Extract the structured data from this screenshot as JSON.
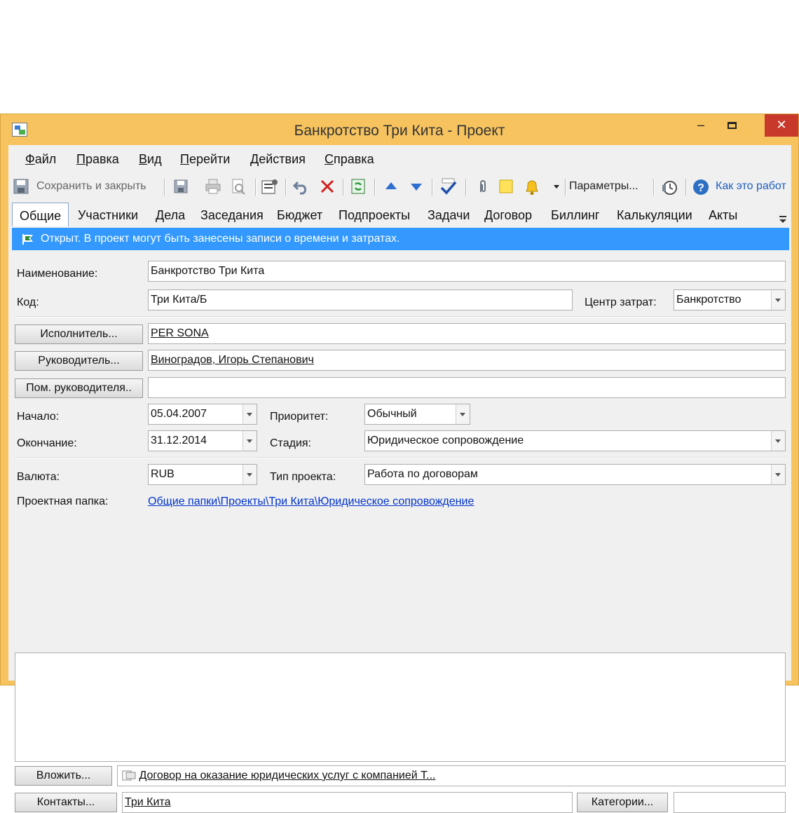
{
  "window": {
    "title": "Банкротство Три Кита - Проект",
    "minimize": "–",
    "close": "✕"
  },
  "menu": [
    "Файл",
    "Правка",
    "Вид",
    "Перейти",
    "Действия",
    "Справка"
  ],
  "toolbar": {
    "save_close": "Сохранить и закрыть",
    "params": "Параметры...",
    "help": "Как это работ"
  },
  "tabs": [
    "Общие",
    "Участники",
    "Дела",
    "Заседания",
    "Бюджет",
    "Подпроекты",
    "Задачи",
    "Договор",
    "Биллинг",
    "Калькуляции",
    "Акты"
  ],
  "info": "Открыт. В проект могут быть занесены записи о времени и затратах.",
  "form": {
    "name_label": "Наименование:",
    "name_value": "Банкротство Три Кита",
    "code_label": "Код:",
    "code_value": "Три Кита/Б",
    "cost_center_label": "Центр затрат:",
    "cost_center_value": "Банкротство",
    "executor_button": "Исполнитель...",
    "executor_value": "PER SONA",
    "manager_button": "Руководитель...",
    "manager_value": "Виноградов, Игорь Степанович",
    "assistant_button": "Пом. руководителя..",
    "assistant_value": "",
    "start_label": "Начало:",
    "start_value": "05.04.2007",
    "priority_label": "Приоритет:",
    "priority_value": "Обычный",
    "end_label": "Окончание:",
    "end_value": "31.12.2014",
    "stage_label": "Стадия:",
    "stage_value": "Юридическое сопровождение",
    "currency_label": "Валюта:",
    "currency_value": "RUB",
    "project_type_label": "Тип проекта:",
    "project_type_value": "Работа по договорам",
    "folder_label": "Проектная папка:",
    "folder_value": "Общие папки\\Проекты\\Три Кита\\Юридическое сопровождение",
    "attach_button": "Вложить...",
    "attach_value": "Договор на оказание юридических услуг с компанией Т...",
    "contacts_button": "Контакты...",
    "contacts_value": "Три Кита",
    "categories_button": "Категории...",
    "categories_value": ""
  },
  "colors": {
    "window_frame": "#f6c35f",
    "info_bar": "#3399ff",
    "close_button": "#c8392b"
  }
}
